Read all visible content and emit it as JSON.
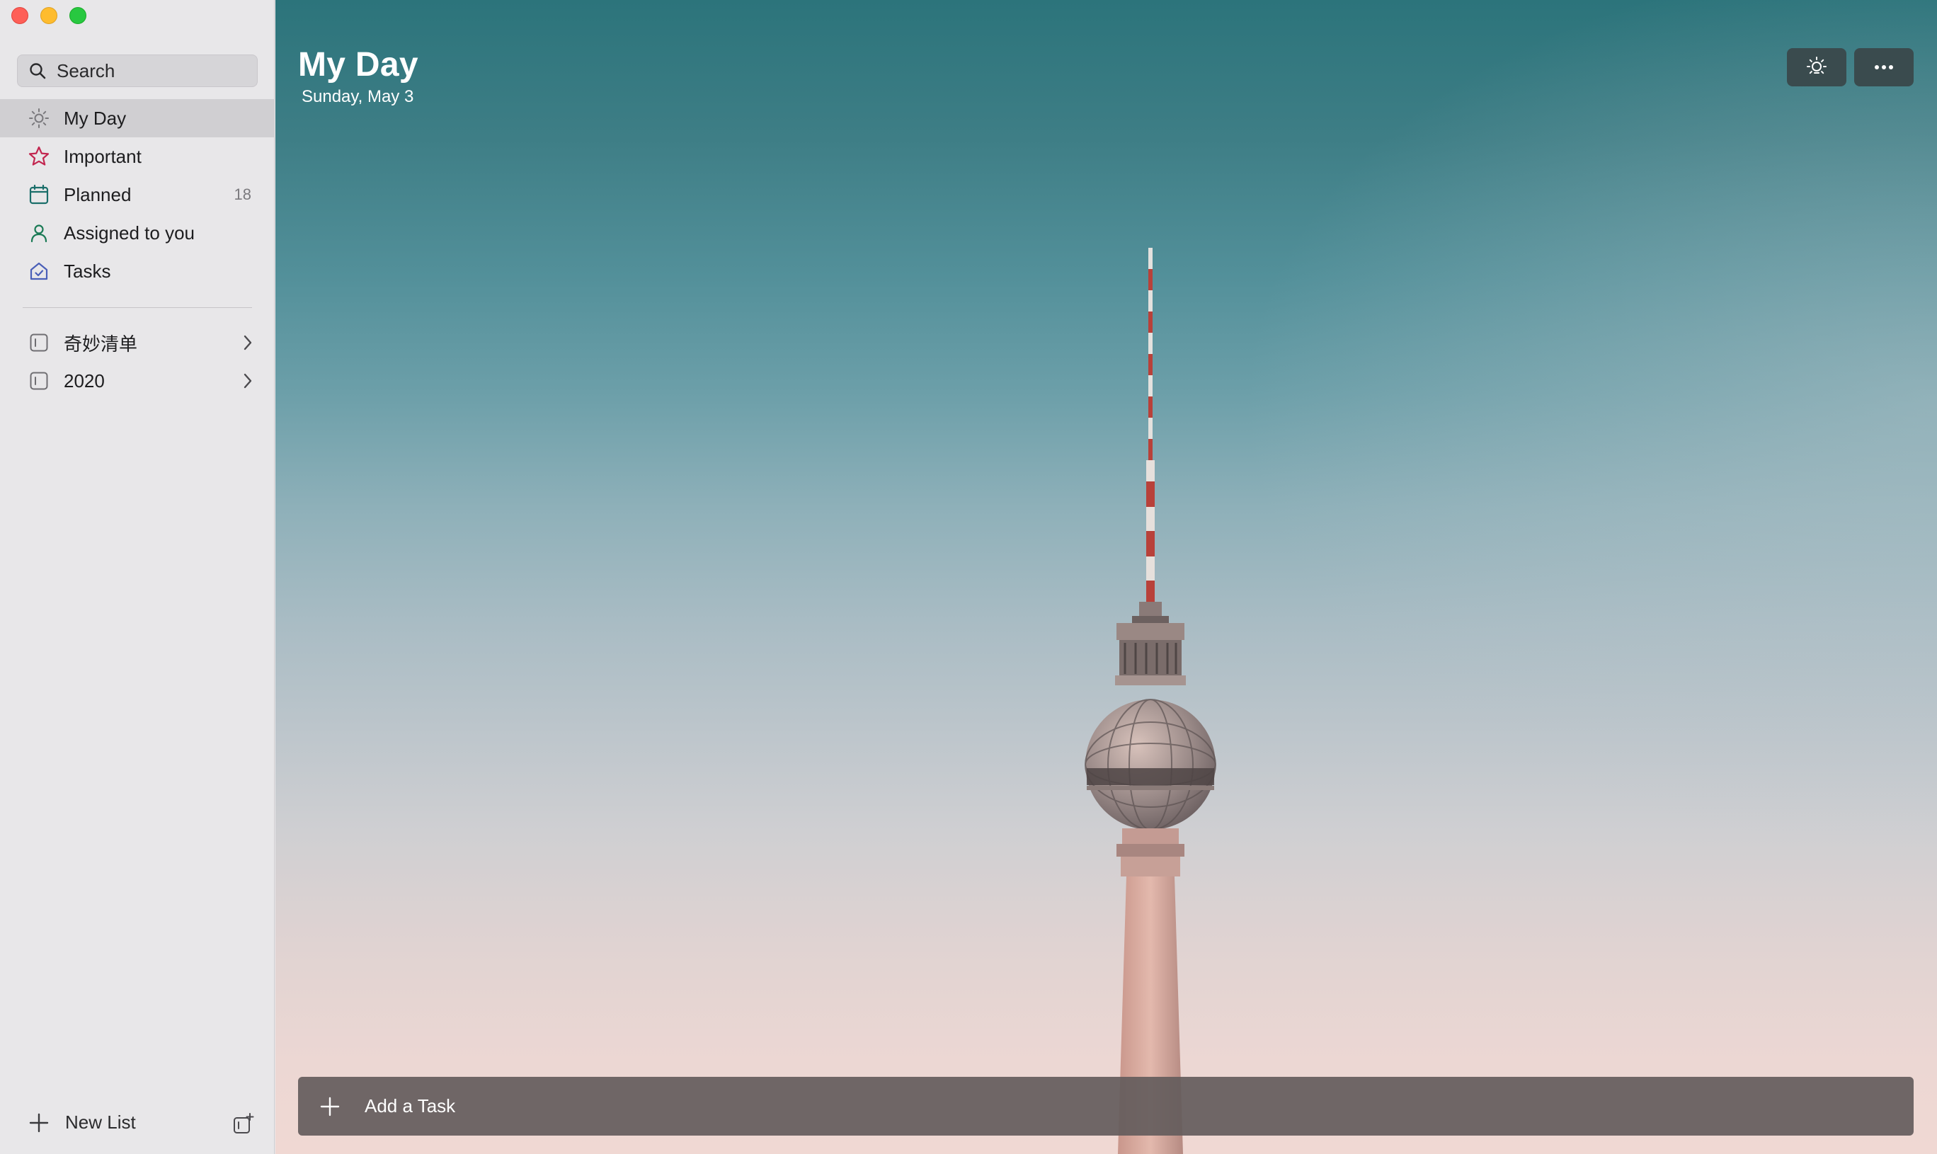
{
  "sidebar": {
    "search": {
      "placeholder": "Search",
      "icon": "search-icon"
    },
    "items": [
      {
        "label": "My Day",
        "icon": "sun-icon",
        "count": "",
        "active": true
      },
      {
        "label": "Important",
        "icon": "star-icon",
        "count": "",
        "color": "#c2264f"
      },
      {
        "label": "Planned",
        "icon": "calendar-icon",
        "count": "18",
        "color": "#1a6e6a"
      },
      {
        "label": "Assigned to you",
        "icon": "person-icon",
        "count": "",
        "color": "#1a7a55"
      },
      {
        "label": "Tasks",
        "icon": "home-icon",
        "count": "",
        "color": "#4a5fb8"
      }
    ],
    "groups": [
      {
        "label": "奇妙清单",
        "icon": "group-icon"
      },
      {
        "label": "2020",
        "icon": "group-icon"
      }
    ],
    "new_list_label": "New List"
  },
  "main": {
    "title": "My Day",
    "date": "Sunday, May 3",
    "add_task_label": "Add a Task"
  }
}
